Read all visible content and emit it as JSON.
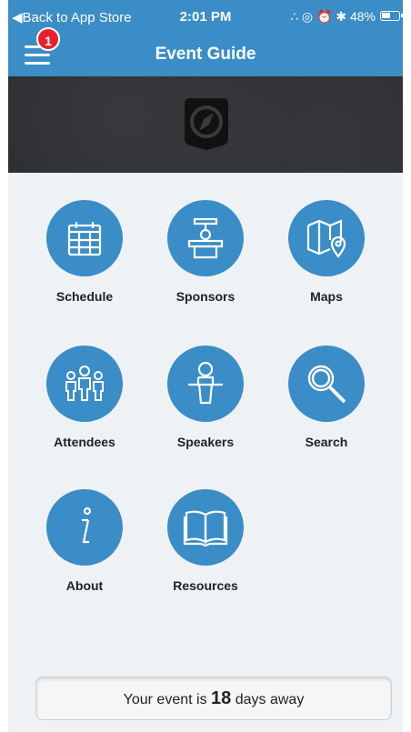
{
  "status": {
    "back_label": "◀Back to App Store",
    "time": "2:01 PM",
    "icons": "∴ ◎ ⏰ ✱",
    "battery": "48%"
  },
  "nav": {
    "title": "Event Guide",
    "badge": "1"
  },
  "hero": {
    "logo": "compass-icon"
  },
  "tiles": [
    {
      "label": "Schedule",
      "icon": "calendar-icon"
    },
    {
      "label": "Sponsors",
      "icon": "podium-icon"
    },
    {
      "label": "Maps",
      "icon": "map-icon"
    },
    {
      "label": "Attendees",
      "icon": "people-icon"
    },
    {
      "label": "Speakers",
      "icon": "speaker-icon"
    },
    {
      "label": "Search",
      "icon": "magnifier-icon"
    },
    {
      "label": "About",
      "icon": "info-icon"
    },
    {
      "label": "Resources",
      "icon": "book-icon"
    }
  ],
  "countdown": {
    "prefix": "Your event is",
    "days": "18",
    "suffix": "days away"
  },
  "colors": {
    "accent": "#3a8dc6",
    "badge": "#e8202c",
    "background": "#eef2f5",
    "hero": "#2b2d30"
  }
}
